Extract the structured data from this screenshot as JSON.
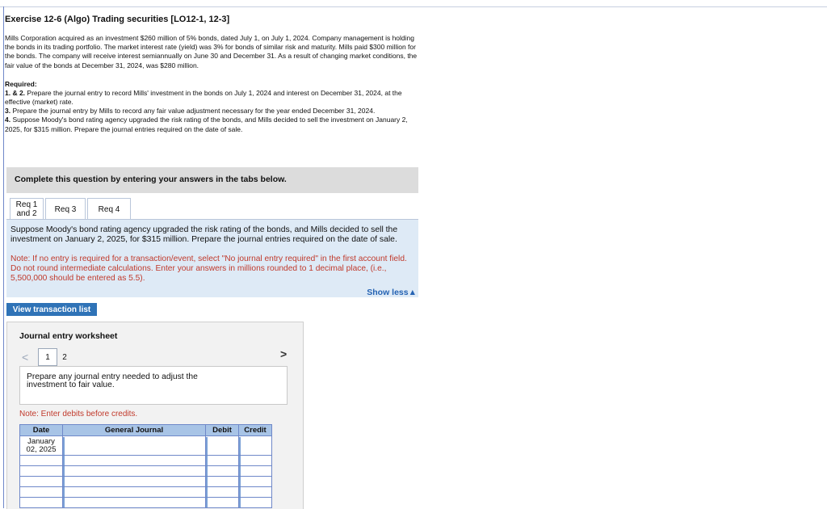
{
  "exercise_title": "Exercise 12-6 (Algo) Trading securities [LO12-1, 12-3]",
  "intro": "Mills Corporation acquired as an investment $260 million of 5% bonds, dated July 1, on July 1, 2024. Company management is holding the bonds in its trading portfolio. The market interest rate (yield) was 3% for bonds of similar risk and maturity. Mills paid $300 million for the bonds. The company will receive interest semiannually on June 30 and December 31. As a result of changing market conditions, the fair value of the bonds at December 31, 2024, was $280 million.",
  "required_heading": "Required:",
  "requirements": [
    {
      "num": "1. & 2.",
      "text": " Prepare the journal entry to record Mills' investment in the bonds on July 1, 2024 and interest on December 31, 2024, at the effective (market) rate."
    },
    {
      "num": "3.",
      "text": " Prepare the journal entry by Mills to record any fair value adjustment necessary for the year ended December 31, 2024."
    },
    {
      "num": "4.",
      "text": " Suppose Moody's bond rating agency upgraded the risk rating of the bonds, and Mills decided to sell the investment on January 2, 2025, for $315 million. Prepare the journal entries required on the date of sale."
    }
  ],
  "banner": "Complete this question by entering your answers in the tabs below.",
  "tabs": {
    "req12_line1": "Req 1",
    "req12_line2": "and 2",
    "req3": "Req 3",
    "req4": "Req 4"
  },
  "panel": {
    "question": "Suppose Moody's bond rating agency upgraded the risk rating of the bonds, and Mills decided to sell the investment on January 2, 2025, for $315 million. Prepare the journal entries required on the date of sale.",
    "note": "Note: If no entry is required for a transaction/event, select \"No journal entry required\" in the first account field. Do not round intermediate calculations. Enter your answers in millions rounded to 1 decimal place, (i.e., 5,500,000 should be entered as 5.5).",
    "show_less": "Show less▲"
  },
  "view_transaction_list": "View transaction list",
  "worksheet": {
    "title": "Journal entry worksheet",
    "prev": "<",
    "page1": "1",
    "page2": "2",
    "next": ">",
    "instruction": "Prepare any journal entry needed to adjust the investment to fair value.",
    "note": "Note: Enter debits before credits.",
    "columns": {
      "date": "Date",
      "general_journal": "General Journal",
      "debit": "Debit",
      "credit": "Credit"
    },
    "first_date_line1": "January",
    "first_date_line2": "02, 2025"
  }
}
